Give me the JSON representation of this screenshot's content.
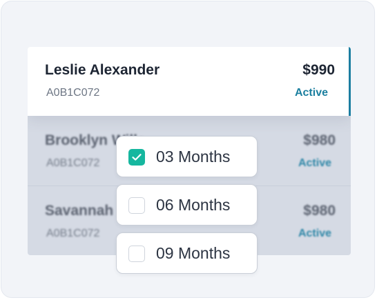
{
  "colors": {
    "accent": "#1c7ea1",
    "status_active": "#1b7f9f",
    "checkbox_checked": "#16b79f",
    "text_primary": "#1d2533",
    "text_secondary": "#6d7684",
    "overlay_bg": "#d5dae4"
  },
  "cards": [
    {
      "name": "Leslie Alexander",
      "code": "A0B1C072",
      "price": "$990",
      "status": "Active",
      "selected": true
    },
    {
      "name": "Brooklyn Wills",
      "code": "A0B1C072",
      "price": "$980",
      "status": "Active",
      "selected": false
    },
    {
      "name": "Savannah Ne",
      "code": "A0B1C072",
      "price": "$980",
      "status": "Active",
      "selected": false
    }
  ],
  "duration_options": [
    {
      "label": "03 Months",
      "checked": true,
      "icon": "check-icon"
    },
    {
      "label": "06 Months",
      "checked": false
    },
    {
      "label": "09 Months",
      "checked": false
    }
  ]
}
